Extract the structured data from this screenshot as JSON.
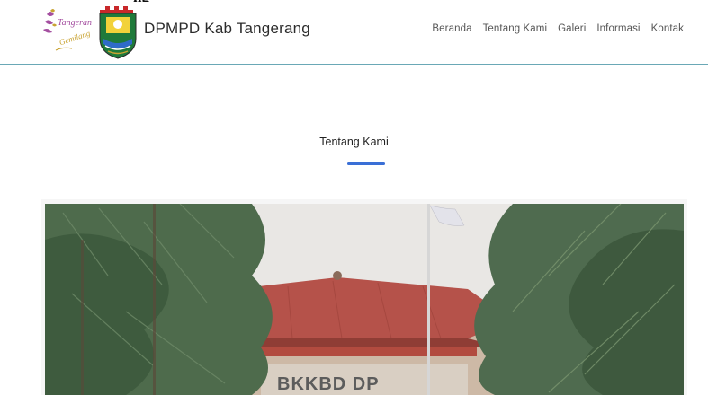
{
  "page": {
    "clipped_title": "ng"
  },
  "header": {
    "brand": "DPMPD Kab Tangerang",
    "logo_tangerang_text": "Tangerang",
    "logo_tangerang_sub": "Gemilang"
  },
  "nav": {
    "items": [
      {
        "label": "Beranda"
      },
      {
        "label": "Tentang Kami"
      },
      {
        "label": "Galeri"
      },
      {
        "label": "Informasi"
      },
      {
        "label": "Kontak"
      }
    ]
  },
  "section": {
    "title": "Tentang Kami",
    "accent_color": "#3a6fd6"
  },
  "photo": {
    "sign_text": "BKKBD DP"
  },
  "colors": {
    "divider": "#6aa8b6",
    "roof": "#b5524a",
    "sky": "#e8e6e3",
    "tree": "#4f6b4f"
  }
}
